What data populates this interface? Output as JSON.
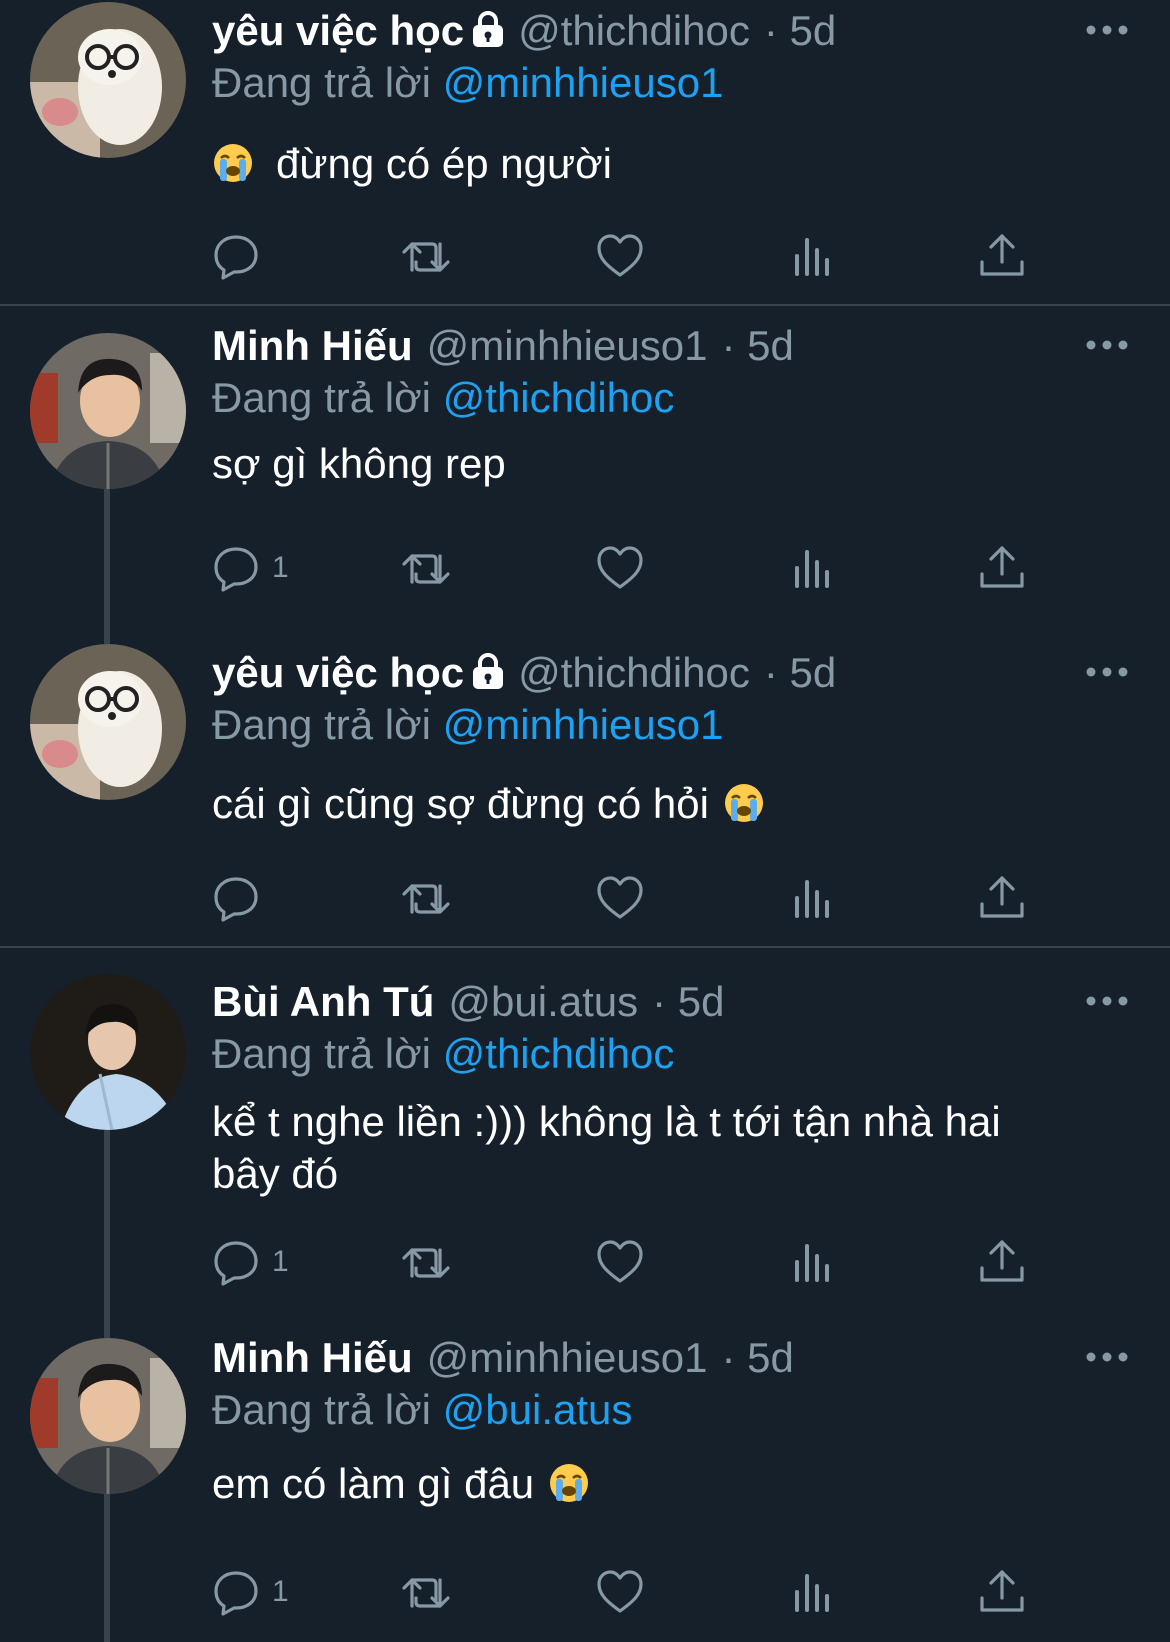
{
  "colors": {
    "background": "#15202b",
    "text": "#ffffff",
    "muted": "#8899a6",
    "accent": "#1da1f2",
    "border": "#38444d"
  },
  "replying_prefix": "Đang trả lời",
  "tweets": [
    {
      "name": "yêu việc học",
      "locked": true,
      "handle": "@thichdihoc",
      "time": "· 5d",
      "reply_to": "@minhhieuso1",
      "text": "đừng có ép người",
      "emoji_before": true,
      "emoji_after": false,
      "reply_count": "",
      "avatar_icon": "dog-avatar"
    },
    {
      "name": "Minh Hiếu",
      "locked": false,
      "handle": "@minhhieuso1",
      "time": "· 5d",
      "reply_to": "@thichdihoc",
      "text": "sợ gì không rep",
      "emoji_before": false,
      "emoji_after": false,
      "reply_count": "1",
      "avatar_icon": "person-avatar"
    },
    {
      "name": "yêu việc học",
      "locked": true,
      "handle": "@thichdihoc",
      "time": "· 5d",
      "reply_to": "@minhhieuso1",
      "text": "cái gì cũng sợ đừng có hỏi",
      "emoji_before": false,
      "emoji_after": true,
      "reply_count": "",
      "avatar_icon": "dog-avatar"
    },
    {
      "name": "Bùi Anh Tú",
      "locked": false,
      "handle": "@bui.atus",
      "time": "· 5d",
      "reply_to": "@thichdihoc",
      "text": "kể t nghe liền :))) không là t tới tận nhà hai bây đó",
      "emoji_before": false,
      "emoji_after": false,
      "reply_count": "1",
      "avatar_icon": "person-avatar"
    },
    {
      "name": "Minh Hiếu",
      "locked": false,
      "handle": "@minhhieuso1",
      "time": "· 5d",
      "reply_to": "@bui.atus",
      "text": "em có làm gì đâu",
      "emoji_before": false,
      "emoji_after": true,
      "reply_count": "1",
      "avatar_icon": "person-avatar"
    }
  ],
  "icons": {
    "more": "more-dots-icon",
    "lock": "lock-icon",
    "reply": "reply-icon",
    "retweet": "retweet-icon",
    "like": "like-icon",
    "views": "views-icon",
    "share": "share-icon",
    "emoji": "loudly-crying-face-emoji"
  }
}
